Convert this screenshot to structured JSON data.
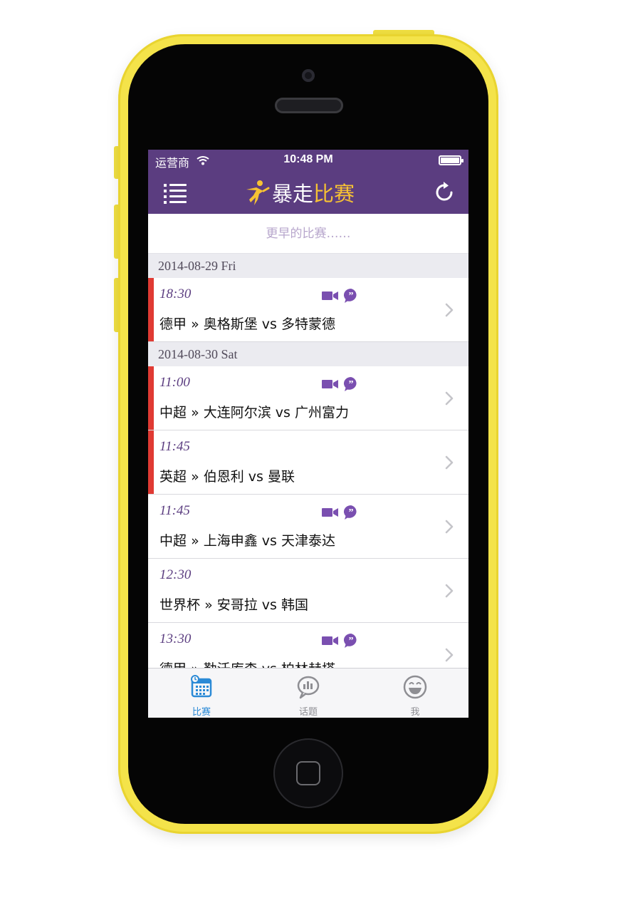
{
  "status_bar": {
    "carrier": "运营商",
    "time": "10:48 PM"
  },
  "navbar": {
    "title_part1": "暴走",
    "title_part2": "比赛",
    "accent_color": "#5b3d80",
    "title_accent": "#f7c233"
  },
  "earlier_link": "更早的比赛……",
  "sections": [
    {
      "date": "2014-08-29 Fri",
      "matches": [
        {
          "time": "18:30",
          "league": "德甲",
          "home": "奥格斯堡",
          "away": "多特蒙德",
          "live": true,
          "video": true,
          "chat": true
        }
      ]
    },
    {
      "date": "2014-08-30 Sat",
      "matches": [
        {
          "time": "11:00",
          "league": "中超",
          "home": "大连阿尔滨",
          "away": "广州富力",
          "live": true,
          "video": true,
          "chat": true
        },
        {
          "time": "11:45",
          "league": "英超",
          "home": "伯恩利",
          "away": "曼联",
          "live": true,
          "video": false,
          "chat": false
        },
        {
          "time": "11:45",
          "league": "中超",
          "home": "上海申鑫",
          "away": "天津泰达",
          "live": false,
          "video": true,
          "chat": true
        },
        {
          "time": "12:30",
          "league": "世界杯",
          "home": "安哥拉",
          "away": "韩国",
          "live": false,
          "video": false,
          "chat": false
        },
        {
          "time": "13:30",
          "league": "德甲",
          "home": "勒沃库森",
          "away": "柏林赫塔",
          "live": false,
          "video": true,
          "chat": true
        }
      ]
    }
  ],
  "vs_label": "vs",
  "separator": "»",
  "tabbar": {
    "tabs": [
      {
        "label": "比赛",
        "icon": "calendar-icon",
        "active": true
      },
      {
        "label": "话题",
        "icon": "chat-bubble-icon",
        "active": false
      },
      {
        "label": "我",
        "icon": "smiley-icon",
        "active": false
      }
    ],
    "active_color": "#2b8ad6"
  }
}
